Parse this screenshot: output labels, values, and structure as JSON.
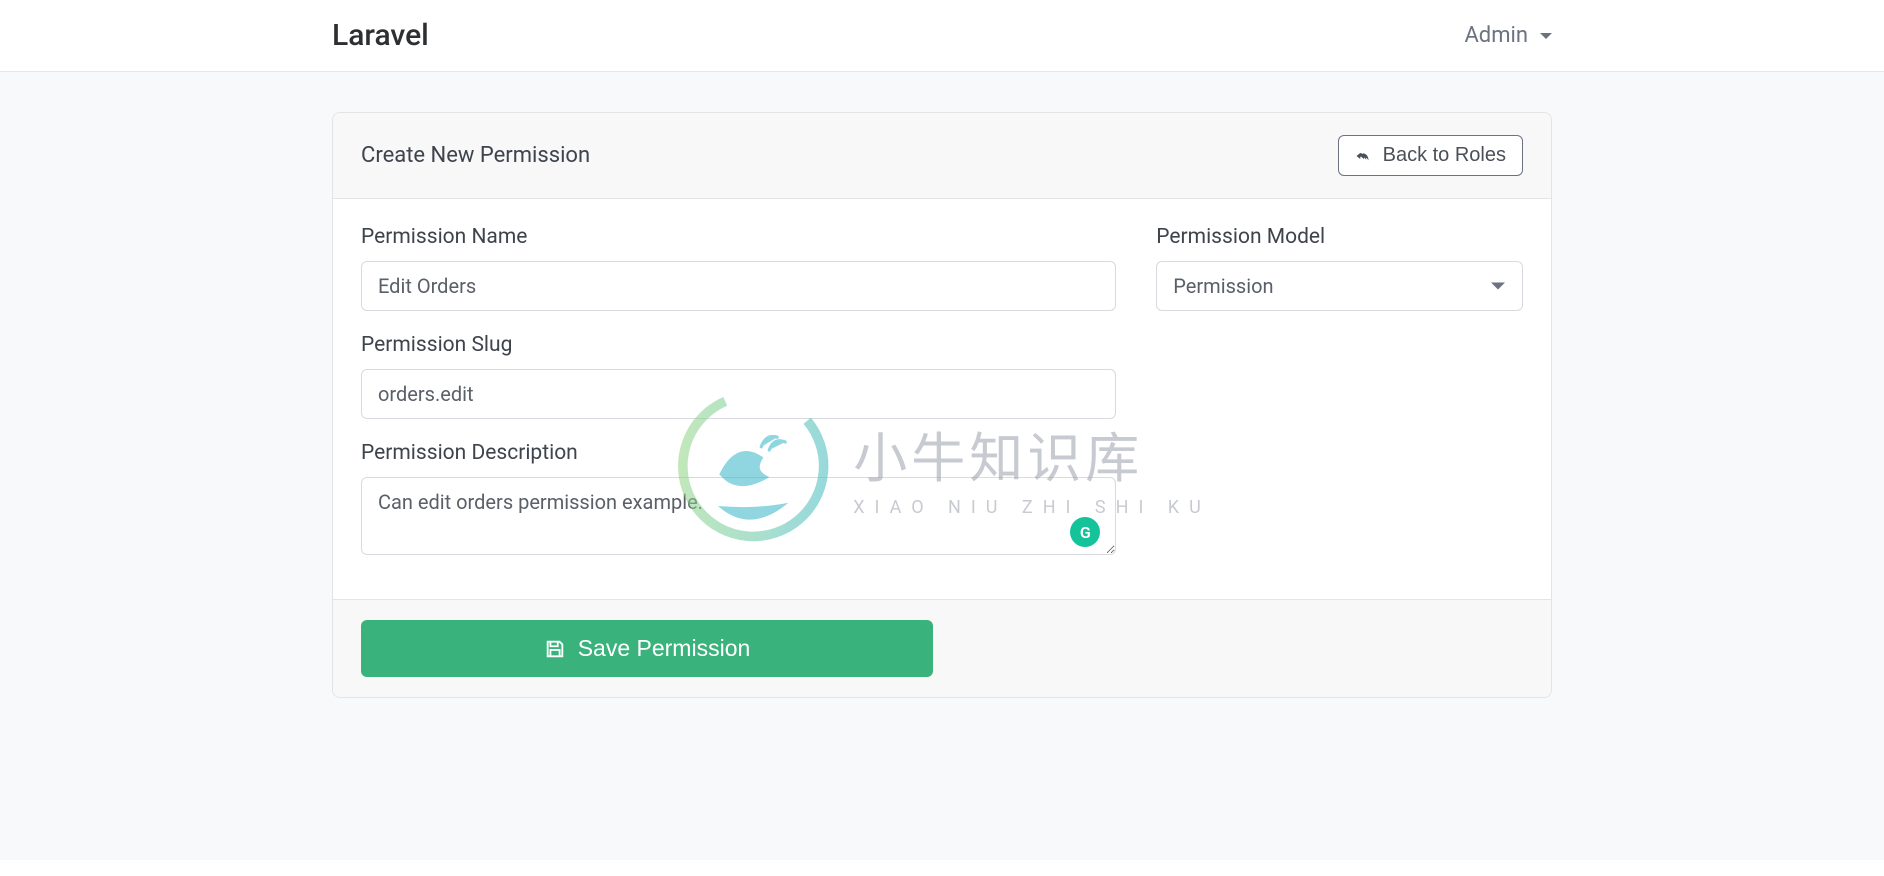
{
  "navbar": {
    "brand": "Laravel",
    "user_label": "Admin"
  },
  "card": {
    "title": "Create New Permission",
    "back_button_label": "Back to Roles"
  },
  "form": {
    "name": {
      "label": "Permission Name",
      "value": "Edit Orders"
    },
    "slug": {
      "label": "Permission Slug",
      "value": "orders.edit"
    },
    "description": {
      "label": "Permission Description",
      "value": "Can edit orders permission example."
    },
    "model": {
      "label": "Permission Model",
      "selected": "Permission",
      "options": [
        "Permission"
      ]
    },
    "save_button_label": "Save Permission"
  },
  "watermark": {
    "cn": "小牛知识库",
    "en": "XIAO NIU ZHI SHI KU"
  },
  "grammarly_badge": "G"
}
